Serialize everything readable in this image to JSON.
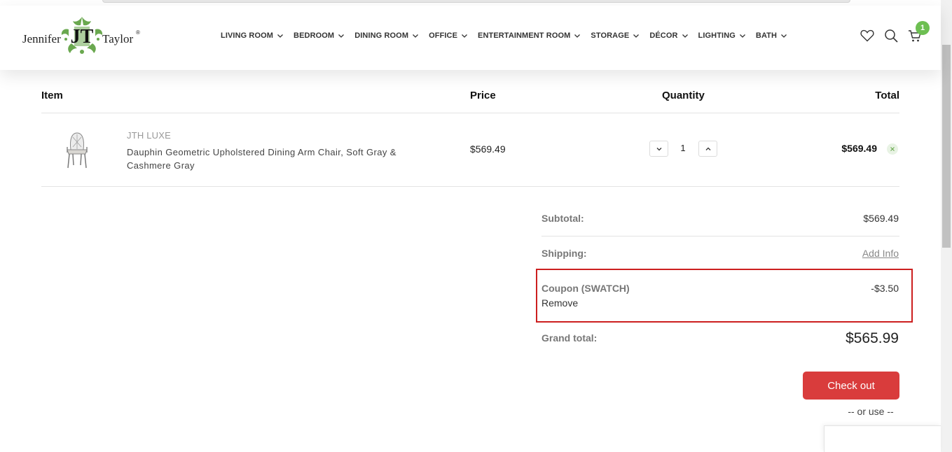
{
  "logo": {
    "word_left": "Jennifer",
    "word_right": "Taylor",
    "registered": "®",
    "monogram": "JT"
  },
  "nav": [
    {
      "label": "LIVING ROOM"
    },
    {
      "label": "BEDROOM"
    },
    {
      "label": "DINING ROOM"
    },
    {
      "label": "OFFICE"
    },
    {
      "label": "ENTERTAINMENT ROOM"
    },
    {
      "label": "STORAGE"
    },
    {
      "label": "DÉCOR"
    },
    {
      "label": "LIGHTING"
    },
    {
      "label": "BATH"
    }
  ],
  "header_icons": {
    "wishlist": "heart-icon",
    "search": "search-icon",
    "cart": "cart-icon",
    "cart_count": "1"
  },
  "table": {
    "headers": {
      "item": "Item",
      "price": "Price",
      "quantity": "Quantity",
      "total": "Total"
    },
    "rows": [
      {
        "brand": "JTH LUXE",
        "name": "Dauphin Geometric Upholstered Dining Arm Chair, Soft Gray & Cashmere Gray",
        "price": "$569.49",
        "quantity": "1",
        "total": "$569.49"
      }
    ]
  },
  "totals": {
    "subtotal_label": "Subtotal:",
    "subtotal_value": "$569.49",
    "shipping_label": "Shipping:",
    "shipping_link": "Add Info",
    "coupon_label": "Coupon (SWATCH)",
    "coupon_value": "-$3.50",
    "coupon_remove": "Remove",
    "grand_label": "Grand total:",
    "grand_value": "$565.99"
  },
  "checkout": {
    "button": "Check out",
    "or_use": "-- or use --"
  },
  "colors": {
    "accent_red": "#d93c3c",
    "highlight_border": "#cc1f1f",
    "badge_green": "#6dbf52",
    "logo_green": "#6aa84f"
  }
}
